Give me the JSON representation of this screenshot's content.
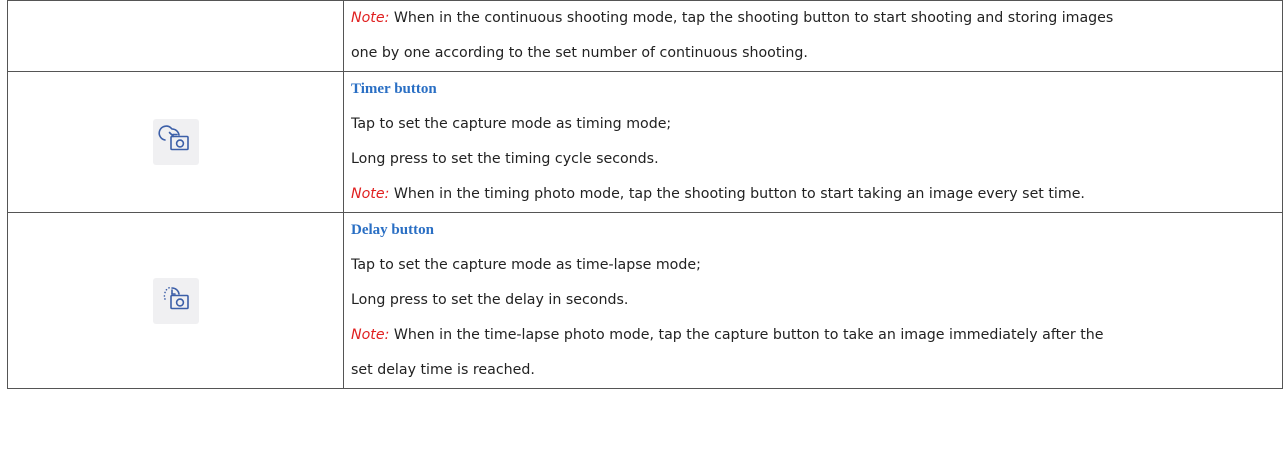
{
  "rows": [
    {
      "lines": [
        {
          "note_label": "Note:",
          "text": " When in the continuous shooting mode, tap the shooting button to start shooting and storing images"
        },
        {
          "text": "one by one according to the set number of continuous shooting."
        }
      ]
    },
    {
      "icon": "timer-camera-icon",
      "title": "Timer button",
      "lines": [
        {
          "text": "Tap to set the capture mode as timing mode;"
        },
        {
          "text": "Long press to set the timing cycle seconds."
        },
        {
          "note_label": "Note:",
          "text": " When in the timing photo mode, tap the shooting button to start taking an image every set time."
        }
      ]
    },
    {
      "icon": "delay-camera-icon",
      "title": "Delay button",
      "lines": [
        {
          "text": "Tap to set the capture mode as time-lapse mode;"
        },
        {
          "text": "Long press to set the delay in seconds."
        },
        {
          "note_label": "Note:",
          "text": " When in the time-lapse photo mode, tap the capture button to take an image immediately after the"
        },
        {
          "text": "set delay time is reached."
        }
      ]
    }
  ],
  "colors": {
    "title": "#2a6fc4",
    "note": "#e02020",
    "icon_stroke": "#3c5fa8",
    "icon_bg": "#f0f0f2"
  }
}
